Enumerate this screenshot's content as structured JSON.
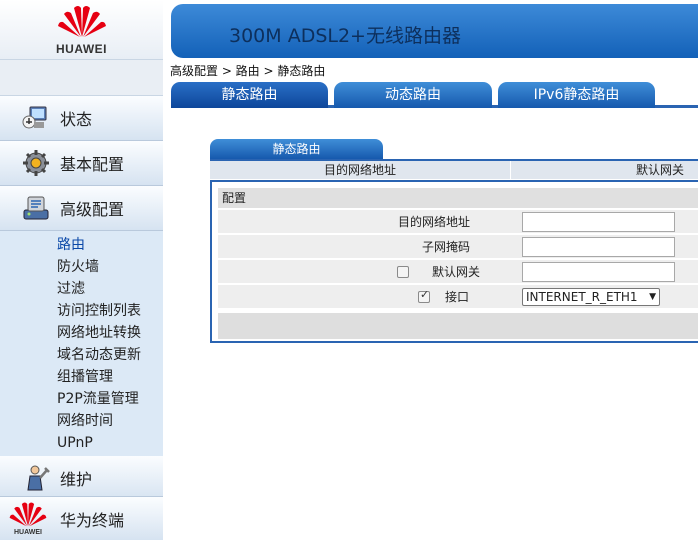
{
  "brand": {
    "name": "HUAWEI",
    "color": "#e60012"
  },
  "sidebar": {
    "items": [
      {
        "label": "状态",
        "icon": "status-monitor-icon"
      },
      {
        "label": "基本配置",
        "icon": "gear-icon"
      },
      {
        "label": "高级配置",
        "icon": "advanced-config-icon"
      }
    ],
    "submenu": [
      "路由",
      "防火墙",
      "过滤",
      "访问控制列表",
      "网络地址转换",
      "域名动态更新",
      "组播管理",
      "P2P流量管理",
      "网络时间",
      "UPnP"
    ],
    "active_submenu": "路由",
    "maintenance": {
      "label": "维护",
      "icon": "maintenance-icon"
    },
    "footer": {
      "label": "华为终端",
      "mini_brand": "HUAWEI"
    }
  },
  "header": {
    "title": "300M ADSL2+无线路由器"
  },
  "breadcrumb": "高级配置 > 路由 > 静态路由",
  "tabs": [
    {
      "label": "静态路由",
      "active": true
    },
    {
      "label": "动态路由",
      "active": false
    },
    {
      "label": "IPv6静态路由",
      "active": false
    }
  ],
  "panel": {
    "tab_label": "静态路由",
    "columns": [
      "目的网络地址",
      "默认网关"
    ],
    "config_title": "配置",
    "fields": {
      "dest": {
        "label": "目的网络地址",
        "value": ""
      },
      "mask": {
        "label": "子网掩码",
        "value": ""
      },
      "gateway": {
        "label": "默认网关",
        "value": "",
        "checked": false
      },
      "iface": {
        "label": "接口",
        "checked": true,
        "selected": "INTERNET_R_ETH1"
      }
    }
  }
}
